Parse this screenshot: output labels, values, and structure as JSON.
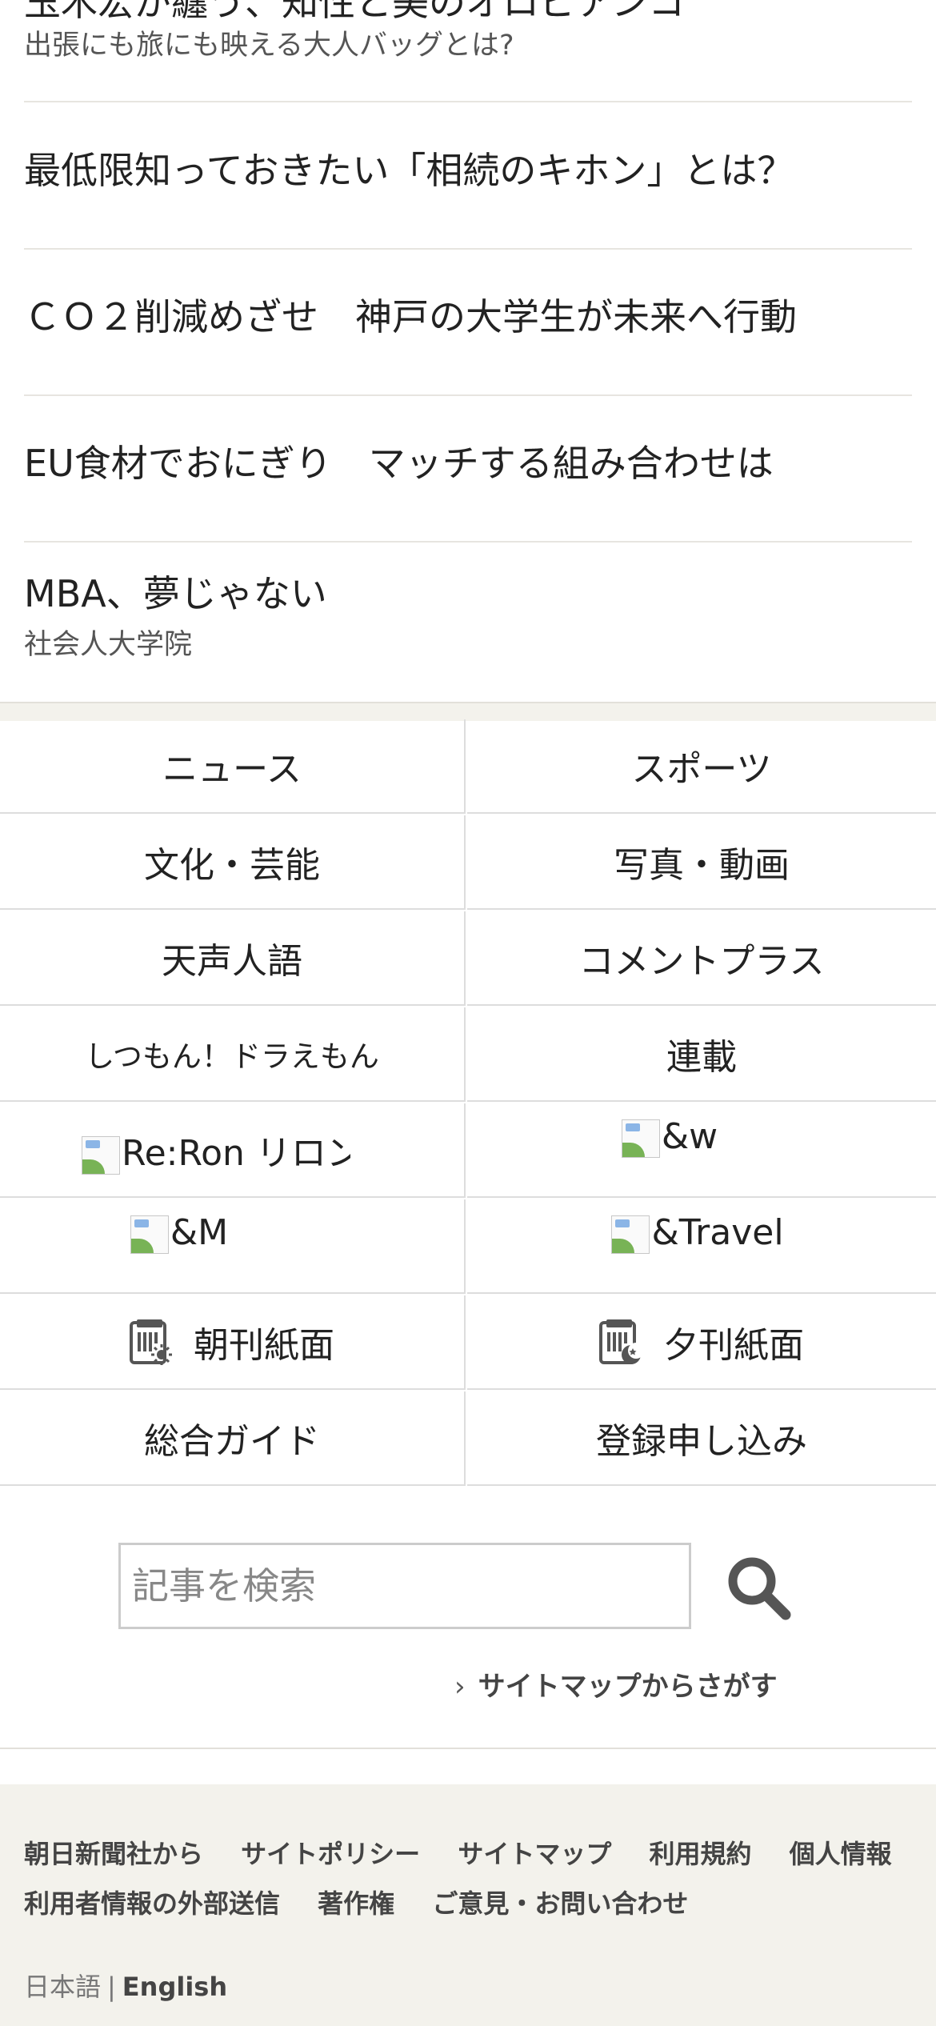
{
  "articles": [
    {
      "title": "玉木宏が纏う、知性と美のオロビアンコ",
      "sub": "出張にも旅にも映える大人バッグとは?"
    },
    {
      "title": "最低限知っておきたい「相続のキホン」とは？",
      "sub": ""
    },
    {
      "title": "ＣＯ２削減めざせ　神戸の大学生が未来へ行動",
      "sub": ""
    },
    {
      "title": "EU食材でおにぎり　マッチする組み合わせは",
      "sub": ""
    },
    {
      "title": "MBA、夢じゃない",
      "sub": "社会人大学院"
    }
  ],
  "categories": [
    {
      "label": "ニュース",
      "icon": ""
    },
    {
      "label": "スポーツ",
      "icon": ""
    },
    {
      "label": "文化・芸能",
      "icon": ""
    },
    {
      "label": "写真・動画",
      "icon": ""
    },
    {
      "label": "天声人語",
      "icon": ""
    },
    {
      "label": "コメントプラス",
      "icon": ""
    },
    {
      "label": "しつもん！ドラえもん",
      "icon": ""
    },
    {
      "label": "連載",
      "icon": ""
    },
    {
      "label": "Re:Ron リロン",
      "icon": "broken-image-icon"
    },
    {
      "label": "&w",
      "icon": "broken-image-icon"
    },
    {
      "label": "&M",
      "icon": "broken-image-icon"
    },
    {
      "label": "&Travel",
      "icon": "broken-image-icon"
    },
    {
      "label": "朝刊紙面",
      "icon": "morning-paper-icon"
    },
    {
      "label": "夕刊紙面",
      "icon": "evening-paper-icon"
    },
    {
      "label": "総合ガイド",
      "icon": ""
    },
    {
      "label": "登録申し込み",
      "icon": ""
    }
  ],
  "search": {
    "placeholder": "記事を検索",
    "button_icon": "search-icon",
    "sitemap_link": "サイトマップからさがす"
  },
  "footer": {
    "links_row1": [
      "朝日新聞社から",
      "サイトポリシー",
      "サイトマップ",
      "利用規約",
      "個人情報"
    ],
    "links_row2": [
      "利用者情報の外部送信",
      "著作権",
      "ご意見・お問い合わせ"
    ],
    "lang_ja": "日本語",
    "lang_sep": "|",
    "lang_en": "English"
  },
  "colors": {
    "background": "#ffffff",
    "footer_bg": "#f3f2ec",
    "divider": "#dddddd",
    "text": "#222222"
  }
}
